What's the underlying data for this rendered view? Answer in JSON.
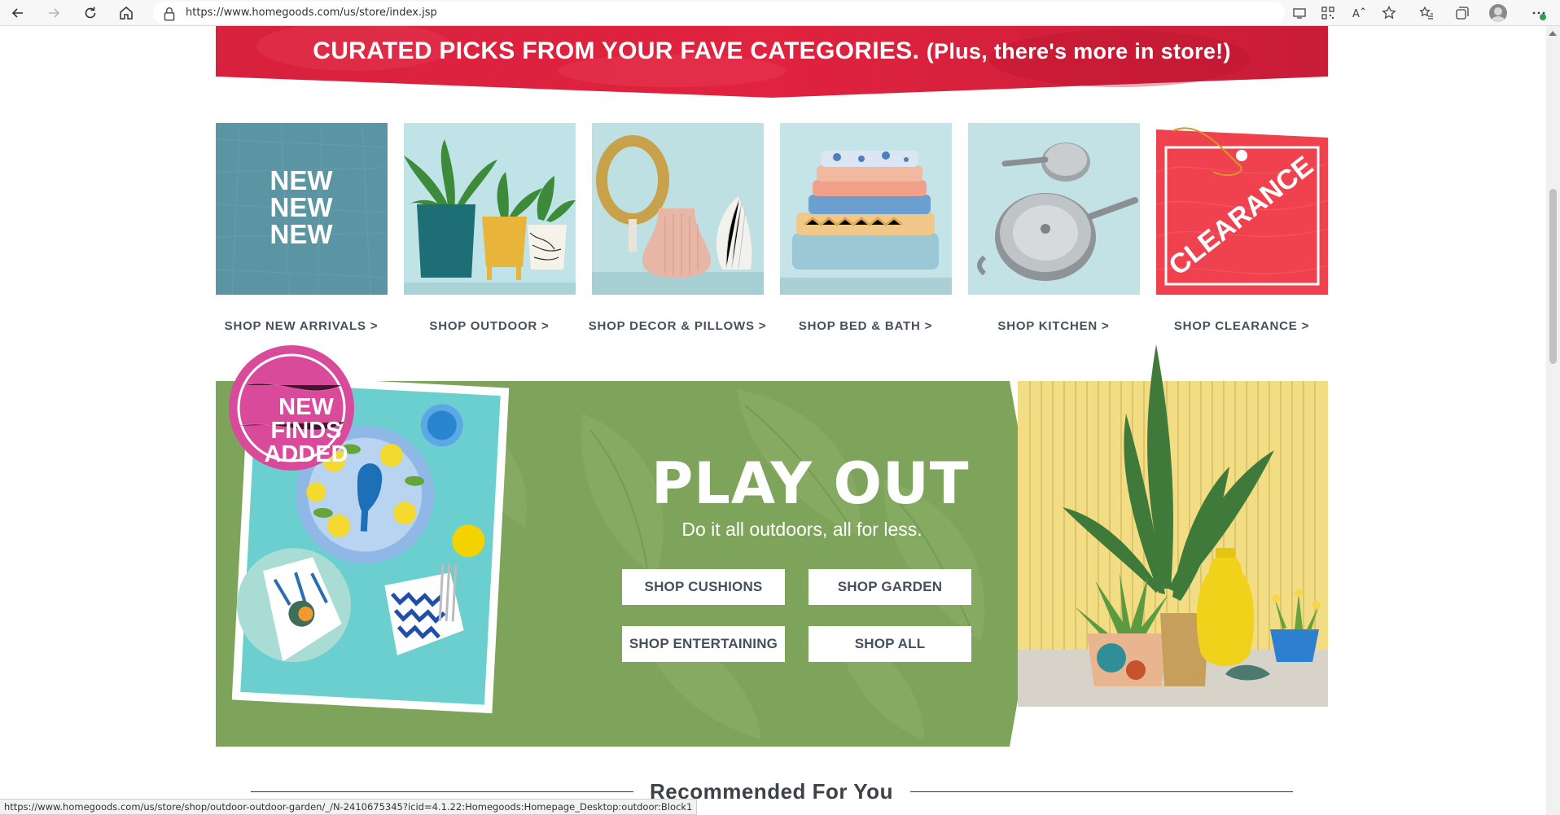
{
  "browser": {
    "url": "https://www.homegoods.com/us/store/index.jsp",
    "status_url": "https://www.homegoods.com/us/store/shop/outdoor-outdoor-garden/_/N-2410675345?icid=4.1.22:Homegoods:Homepage_Desktop:outdoor:Block1",
    "icons": [
      "back-icon",
      "forward-icon",
      "refresh-icon",
      "home-icon",
      "lock-icon",
      "app-available-icon",
      "qr-code-icon",
      "read-aloud-icon",
      "favorite-icon",
      "favorites-bar-icon",
      "collections-icon",
      "profile-icon",
      "more-icon"
    ]
  },
  "banner": {
    "headline": "CURATED PICKS FROM YOUR FAVE CATEGORIES.",
    "subline": "(Plus, there's more in store!)",
    "color": "#d41f3c"
  },
  "categories": [
    {
      "label": "SHOP NEW ARRIVALS >",
      "tile_text": [
        "NEW",
        "NEW",
        "NEW"
      ]
    },
    {
      "label": "SHOP OUTDOOR >"
    },
    {
      "label": "SHOP DECOR & PILLOWS >"
    },
    {
      "label": "SHOP BED & BATH >"
    },
    {
      "label": "SHOP KITCHEN >"
    },
    {
      "label": "SHOP CLEARANCE >",
      "tile_text": "CLEARANCE"
    }
  ],
  "hero": {
    "badge": [
      "NEW",
      "FINDS",
      "ADDED"
    ],
    "title": "PLAY OUT",
    "subtitle": "Do it all outdoors, all for less.",
    "buttons": {
      "cushions": "SHOP CUSHIONS",
      "garden": "SHOP GARDEN",
      "entertaining": "SHOP ENTERTAINING",
      "all": "SHOP ALL"
    },
    "green": "#7ea35a",
    "badge_color": "#d94a9b"
  },
  "recommended": {
    "title": "Recommended For You"
  }
}
